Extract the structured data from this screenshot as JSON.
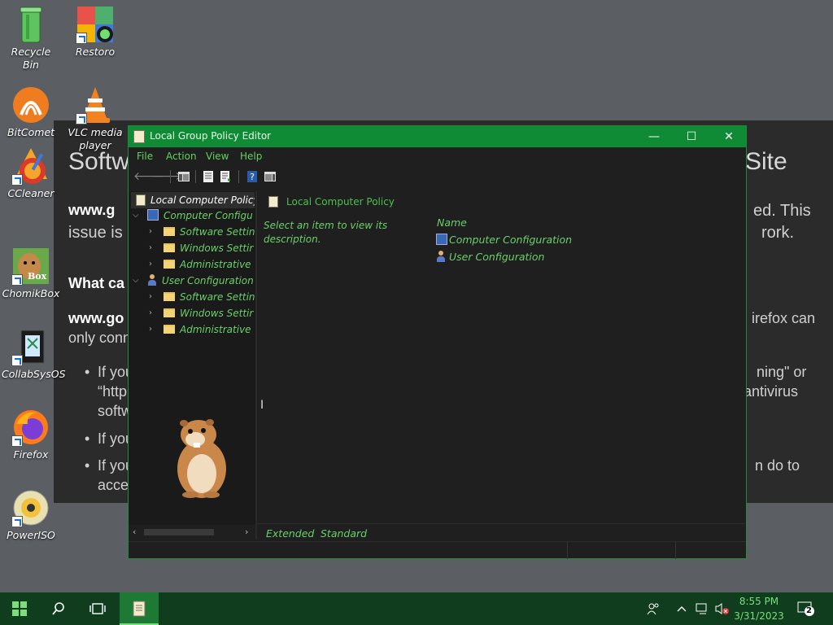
{
  "desktop": {
    "icons": [
      {
        "label": "Recycle Bin",
        "icon": "recycle-bin-icon"
      },
      {
        "label": "Restoro",
        "icon": "restoro-icon"
      },
      {
        "label": "BitComet",
        "icon": "bitcomet-icon"
      },
      {
        "label": "VLC media player",
        "icon": "vlc-icon"
      },
      {
        "label": "CCleaner",
        "icon": "ccleaner-icon"
      },
      {
        "label": "ChomikBox",
        "icon": "chomikbox-icon"
      },
      {
        "label": "CollabSysOS",
        "icon": "collabsysos-icon"
      },
      {
        "label": "Firefox",
        "icon": "firefox-icon"
      },
      {
        "label": "PowerISO",
        "icon": "poweriso-icon"
      }
    ],
    "chomik_badge": "Box"
  },
  "background_page": {
    "heading_left": "Softw",
    "heading_right": "Site",
    "line1_left": "www.g",
    "line1_right": "ed. This",
    "line2_left": "issue is c",
    "line2_right": "rork.",
    "q_left": "What ca",
    "l3_left": "www.go",
    "l3_right": "irefox can",
    "l4_left": "only conn",
    "b1_left": "If you",
    "b1_right": "ning\" or",
    "b1b_left": "“http",
    "b1b_right": "antivirus",
    "b1c_left": "softw",
    "b2_left": "If you",
    "b3_left": "If you",
    "b3_right": "n do to",
    "b3b_left": "acces"
  },
  "window": {
    "title": "Local Group Policy Editor",
    "controls": {
      "minimize": "—",
      "maximize": "☐",
      "close": "✕"
    },
    "menu": [
      "File",
      "Action",
      "View",
      "Help"
    ],
    "tree": {
      "root": "Local Computer Policy",
      "items": [
        {
          "label": "Computer Configu",
          "level": 1,
          "chev": "⌵",
          "kind": "computer"
        },
        {
          "label": "Software Settin",
          "level": 2,
          "chev": "›",
          "kind": "folder"
        },
        {
          "label": "Windows Settir",
          "level": 2,
          "chev": "›",
          "kind": "folder"
        },
        {
          "label": "Administrative",
          "level": 2,
          "chev": "›",
          "kind": "folder"
        },
        {
          "label": "User Configuration",
          "level": 1,
          "chev": "⌵",
          "kind": "user"
        },
        {
          "label": "Software Settin",
          "level": 2,
          "chev": "›",
          "kind": "folder"
        },
        {
          "label": "Windows Settir",
          "level": 2,
          "chev": "›",
          "kind": "folder"
        },
        {
          "label": "Administrative",
          "level": 2,
          "chev": "›",
          "kind": "folder"
        }
      ]
    },
    "right": {
      "header": "Local Computer Policy",
      "description": "Select an item to view its description.",
      "column_name": "Name",
      "items": [
        "Computer Configuration",
        "User Configuration"
      ]
    },
    "tabs": [
      "Extended",
      "Standard"
    ]
  },
  "taskbar": {
    "time": "8:55 PM",
    "date": "3/31/2023",
    "notifications": "2"
  },
  "colors": {
    "accent": "#0f8a35",
    "text_green": "#6ad06a",
    "taskbar": "#0f3d1e"
  }
}
